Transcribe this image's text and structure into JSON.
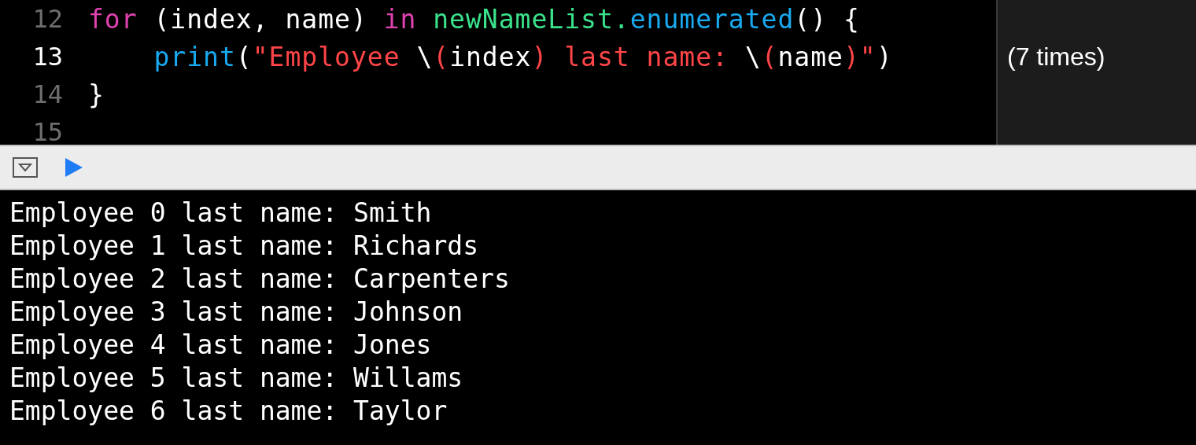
{
  "editor": {
    "lines": [
      {
        "number": "12",
        "current": false,
        "tokens": [
          {
            "kind": "keyword",
            "text": "for"
          },
          {
            "kind": "plain",
            "text": " (index, name) "
          },
          {
            "kind": "keyword",
            "text": "in"
          },
          {
            "kind": "type",
            "text": " newNameList."
          },
          {
            "kind": "func",
            "text": "enumerated"
          },
          {
            "kind": "plain",
            "text": "() {"
          }
        ]
      },
      {
        "number": "13",
        "current": true,
        "result": "(7 times)",
        "tokens": [
          {
            "kind": "func",
            "text": "    print"
          },
          {
            "kind": "plain",
            "text": "("
          },
          {
            "kind": "string",
            "text": "\"Employee "
          },
          {
            "kind": "plain",
            "text": "\\"
          },
          {
            "kind": "string",
            "text": "("
          },
          {
            "kind": "plain",
            "text": "index"
          },
          {
            "kind": "string",
            "text": ") last name: "
          },
          {
            "kind": "plain",
            "text": "\\"
          },
          {
            "kind": "string",
            "text": "("
          },
          {
            "kind": "plain",
            "text": "name"
          },
          {
            "kind": "string",
            "text": ")\""
          },
          {
            "kind": "plain",
            "text": ")"
          }
        ]
      },
      {
        "number": "14",
        "current": false,
        "tokens": [
          {
            "kind": "plain",
            "text": "}"
          }
        ]
      },
      {
        "number": "15",
        "current": false
      }
    ]
  },
  "console": {
    "lines": [
      "Employee 0 last name: Smith",
      "Employee 1 last name: Richards",
      "Employee 2 last name: Carpenters",
      "Employee 3 last name: Johnson",
      "Employee 4 last name: Jones",
      "Employee 5 last name: Willams",
      "Employee 6 last name: Taylor"
    ]
  }
}
